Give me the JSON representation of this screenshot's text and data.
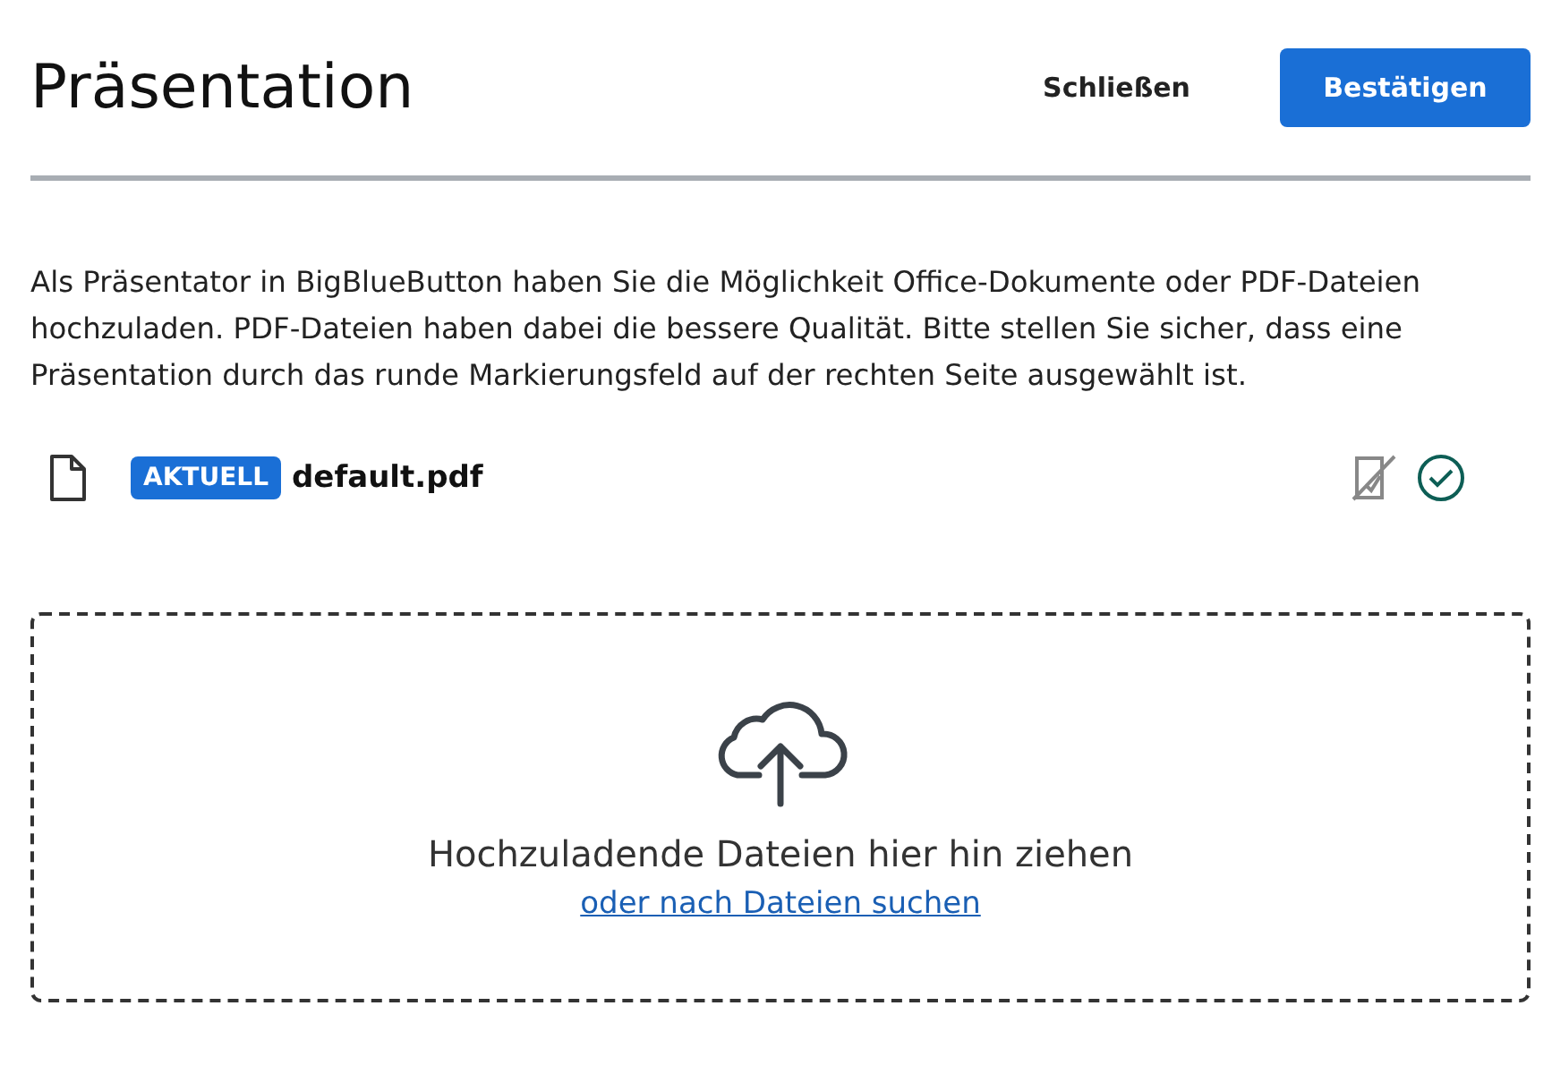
{
  "header": {
    "title": "Präsentation",
    "close_label": "Schließen",
    "confirm_label": "Bestätigen"
  },
  "intro": "Als Präsentator in BigBlueButton haben Sie die Möglichkeit Office-Dokumente oder PDF-Dateien hochzuladen. PDF-Dateien haben dabei die bessere Qualität. Bitte stellen Sie sicher, dass eine Präsentation durch das runde Markierungsfeld auf der rechten Seite ausgewählt ist.",
  "files": [
    {
      "badge": "AKTUELL",
      "name": "default.pdf",
      "current": true,
      "selected": true
    }
  ],
  "dropzone": {
    "message": "Hochzuladende Dateien hier hin ziehen",
    "link": "oder nach Dateien suchen"
  }
}
